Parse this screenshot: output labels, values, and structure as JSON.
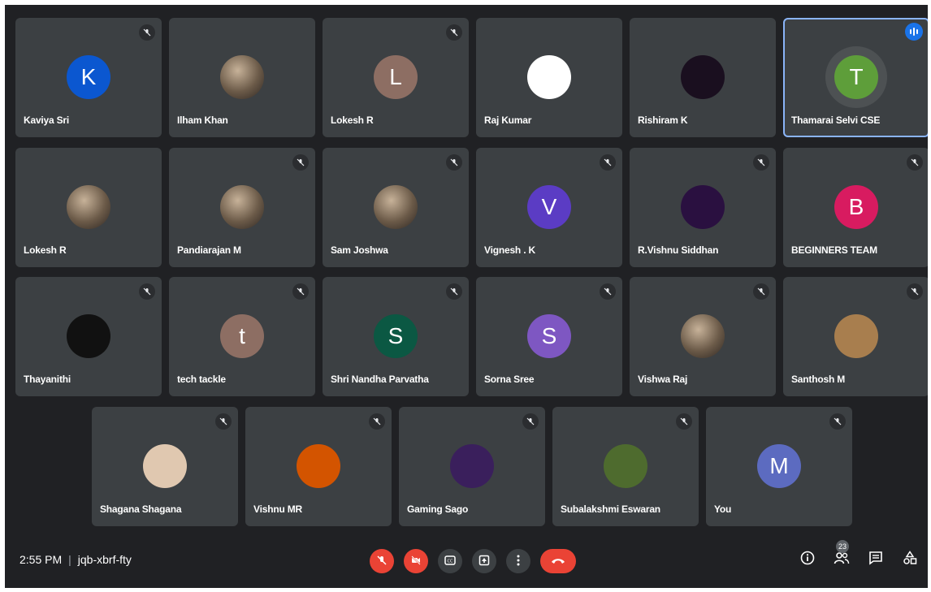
{
  "participants": [
    {
      "name": "Kaviya Sri",
      "initial": "K",
      "color": "#0b57d0",
      "muted": true
    },
    {
      "name": "Ilham Khan",
      "initial": "",
      "color": "",
      "muted": false
    },
    {
      "name": "Lokesh R",
      "initial": "L",
      "color": "#8d6e63",
      "muted": true
    },
    {
      "name": "Raj Kumar",
      "initial": "",
      "color": "#ffffff",
      "muted": false
    },
    {
      "name": "Rishiram K",
      "initial": "",
      "color": "#1a0f1f",
      "muted": false
    },
    {
      "name": "Thamarai Selvi CSE",
      "initial": "T",
      "color": "#5e9e3a",
      "muted": false,
      "speaking": true
    },
    {
      "name": "Lokesh R",
      "initial": "",
      "color": "",
      "muted": false
    },
    {
      "name": "Pandiarajan M",
      "initial": "",
      "color": "",
      "muted": true
    },
    {
      "name": "Sam Joshwa",
      "initial": "",
      "color": "",
      "muted": true
    },
    {
      "name": "Vignesh . K",
      "initial": "V",
      "color": "#5b3cc4",
      "muted": true
    },
    {
      "name": "R.Vishnu Siddhan",
      "initial": "",
      "color": "#2a1040",
      "muted": true
    },
    {
      "name": "BEGINNERS TEAM",
      "initial": "B",
      "color": "#d81b60",
      "muted": true
    },
    {
      "name": "Thayanithi",
      "initial": "",
      "color": "#111111",
      "muted": true
    },
    {
      "name": "tech tackle",
      "initial": "t",
      "color": "#8d6e63",
      "muted": true
    },
    {
      "name": "Shri Nandha Parvatha",
      "initial": "S",
      "color": "#0b5843",
      "muted": true
    },
    {
      "name": "Sorna Sree",
      "initial": "S",
      "color": "#7e57c2",
      "muted": true
    },
    {
      "name": "Vishwa Raj",
      "initial": "",
      "color": "",
      "muted": true
    },
    {
      "name": "Santhosh M",
      "initial": "",
      "color": "#a87e4e",
      "muted": true
    },
    {
      "name": "Shagana Shagana",
      "initial": "",
      "color": "#e0c8b0",
      "muted": true
    },
    {
      "name": "Vishnu MR",
      "initial": "",
      "color": "#d35400",
      "muted": true
    },
    {
      "name": "Gaming Sago",
      "initial": "",
      "color": "#3a1f5c",
      "muted": true
    },
    {
      "name": "Subalakshmi Eswaran",
      "initial": "",
      "color": "#4e6b2e",
      "muted": true
    },
    {
      "name": "You",
      "initial": "M",
      "color": "#5c6bc0",
      "muted": true
    }
  ],
  "meeting": {
    "time": "2:55 PM",
    "separator": "|",
    "code": "jqb-xbrf-fty"
  },
  "controls": [
    {
      "name": "mic-off",
      "icon": "mic-off-icon",
      "glyph": "🎙"
    },
    {
      "name": "camera-off",
      "icon": "camera-off-icon",
      "glyph": "⊘"
    },
    {
      "name": "captions",
      "icon": "captions-icon",
      "glyph": "CC"
    },
    {
      "name": "present",
      "icon": "present-icon",
      "glyph": "▲"
    },
    {
      "name": "more-options",
      "icon": "more-vert-icon",
      "glyph": "⋮"
    },
    {
      "name": "leave-call",
      "icon": "call-end-icon",
      "glyph": "☎"
    }
  ],
  "right_tools": {
    "participants_count": "23"
  }
}
